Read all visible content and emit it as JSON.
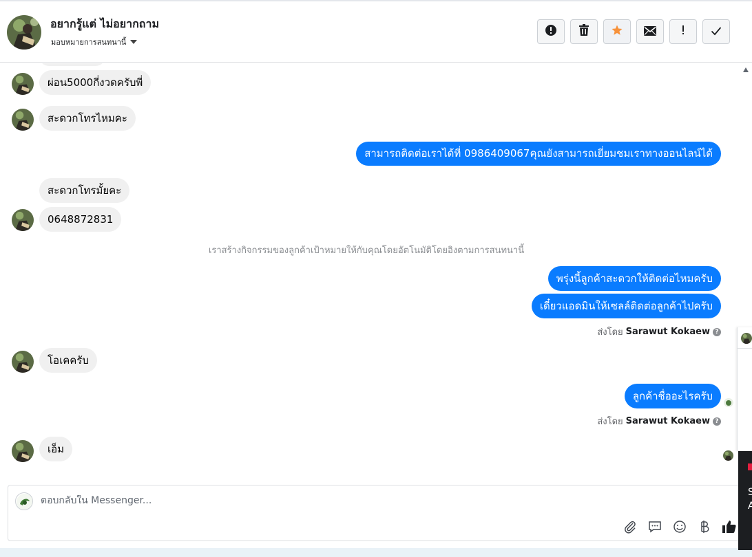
{
  "header": {
    "contact_name": "อยากรู้แต่ ไม่อยากถาม",
    "assign_label": "มอบหมายการสนทนานี้",
    "actions": [
      {
        "name": "report-icon",
        "symbol": "!"
      },
      {
        "name": "trash-icon",
        "symbol": "🗑"
      },
      {
        "name": "star-icon",
        "symbol": "★"
      },
      {
        "name": "mail-icon",
        "symbol": "✉"
      },
      {
        "name": "exclamation-icon",
        "symbol": "!"
      },
      {
        "name": "check-icon",
        "symbol": "✓"
      }
    ]
  },
  "messages": [
    {
      "dir": "in",
      "text": "ผ่อน5000กี่งวดครับพี่"
    },
    {
      "dir": "in",
      "text": "สะดวกโทรไหมคะ"
    },
    {
      "dir": "out",
      "text": "สามารถติดต่อเราได้ที่ 0986409067คุณยังสามารถเยี่ยมชมเราทางออนไลน์ได้"
    },
    {
      "dir": "in",
      "text": "สะดวกโทรมั้ยคะ"
    },
    {
      "dir": "in",
      "text": "0648872831"
    },
    {
      "dir": "system",
      "text": "เราสร้างกิจกรรมของลูกค้าเป้าหมายให้กับคุณโดยอัตโนมัติโดยอิงตามการสนทนานี้"
    },
    {
      "dir": "out",
      "text": "พรุ่งนี้ลูกค้าสะดวกให้ติดต่อไหมครับ"
    },
    {
      "dir": "out",
      "text": "เดี๋ยวแอดมินให้เซลล์ติดต่อลูกค้าไปครับ"
    },
    {
      "dir": "in",
      "text": "โอเคครับ"
    },
    {
      "dir": "out",
      "text": "ลูกค้าชื่ออะไรครับ"
    },
    {
      "dir": "in",
      "text": "เอ็ม"
    }
  ],
  "sent_by": {
    "prefix": "ส่งโดย",
    "agent": "Sarawut Kokaew",
    "help_symbol": "?"
  },
  "composer": {
    "placeholder": "ตอบกลับใน Messenger...",
    "tools": [
      {
        "name": "attachment-icon",
        "symbol": "📎"
      },
      {
        "name": "saved-reply-icon",
        "symbol": "💬"
      },
      {
        "name": "emoji-icon",
        "symbol": "☺"
      },
      {
        "name": "baht-icon",
        "symbol": "฿"
      },
      {
        "name": "like-icon",
        "symbol": "👍"
      }
    ]
  },
  "side_panel": {
    "line1": "S",
    "line2": "A"
  },
  "colors": {
    "outgoing_bubble": "#0a7cff",
    "incoming_bubble": "#f0f0f0",
    "star_accent": "#f7923b"
  }
}
